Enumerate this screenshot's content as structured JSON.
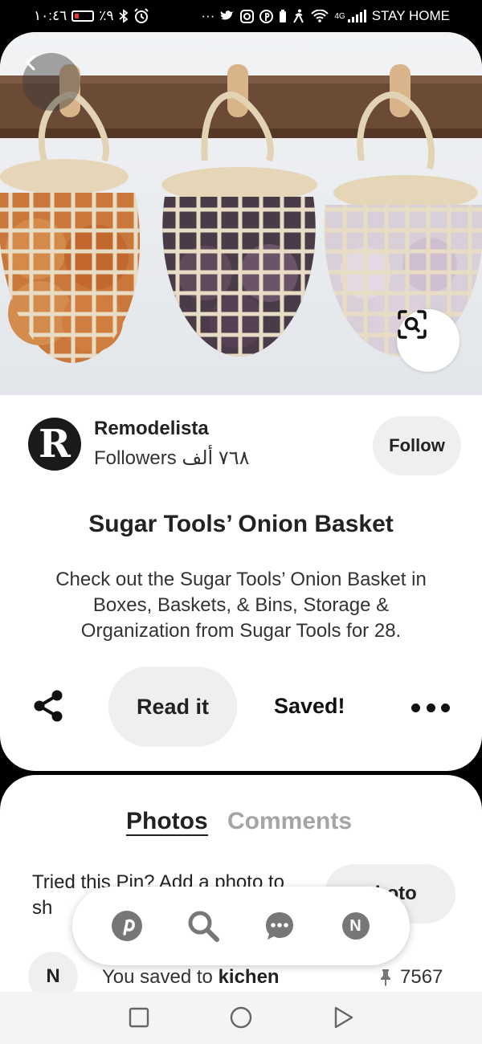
{
  "status_bar": {
    "time": "١٠:٤٦",
    "battery": "٪٩",
    "network": "4G",
    "carrier": "STAY HOME",
    "dots": "···"
  },
  "hero": {
    "back_icon": "chevron-left-icon",
    "lens_icon": "visual-search-icon"
  },
  "creator": {
    "avatar_letter": "R",
    "name": "Remodelista",
    "followers": "Followers ٧٦٨ ألف",
    "follow_label": "Follow"
  },
  "pin": {
    "title": "Sugar Tools’ Onion Basket",
    "description": "Check out the Sugar Tools’ Onion Basket in Boxes, Baskets, & Bins, Storage & Organization from Sugar Tools for 28."
  },
  "actions": {
    "share_icon": "share-icon",
    "read_it_label": "Read it",
    "saved_label": "Saved!",
    "more_icon": "more-icon"
  },
  "tabs": {
    "photos": "Photos",
    "comments": "Comments"
  },
  "tried": {
    "text": "Tried this Pin? Add a photo to sh",
    "button_label": "photo"
  },
  "saved_row": {
    "avatar_letter": "N",
    "prefix": "You saved to ",
    "board": "kichen",
    "count": "7567"
  },
  "float_nav": {
    "items": [
      "pinterest-icon",
      "search-icon",
      "messages-icon",
      "profile-icon"
    ],
    "profile_letter": "N"
  },
  "system_nav": [
    "recents-button",
    "home-button",
    "back-button"
  ]
}
